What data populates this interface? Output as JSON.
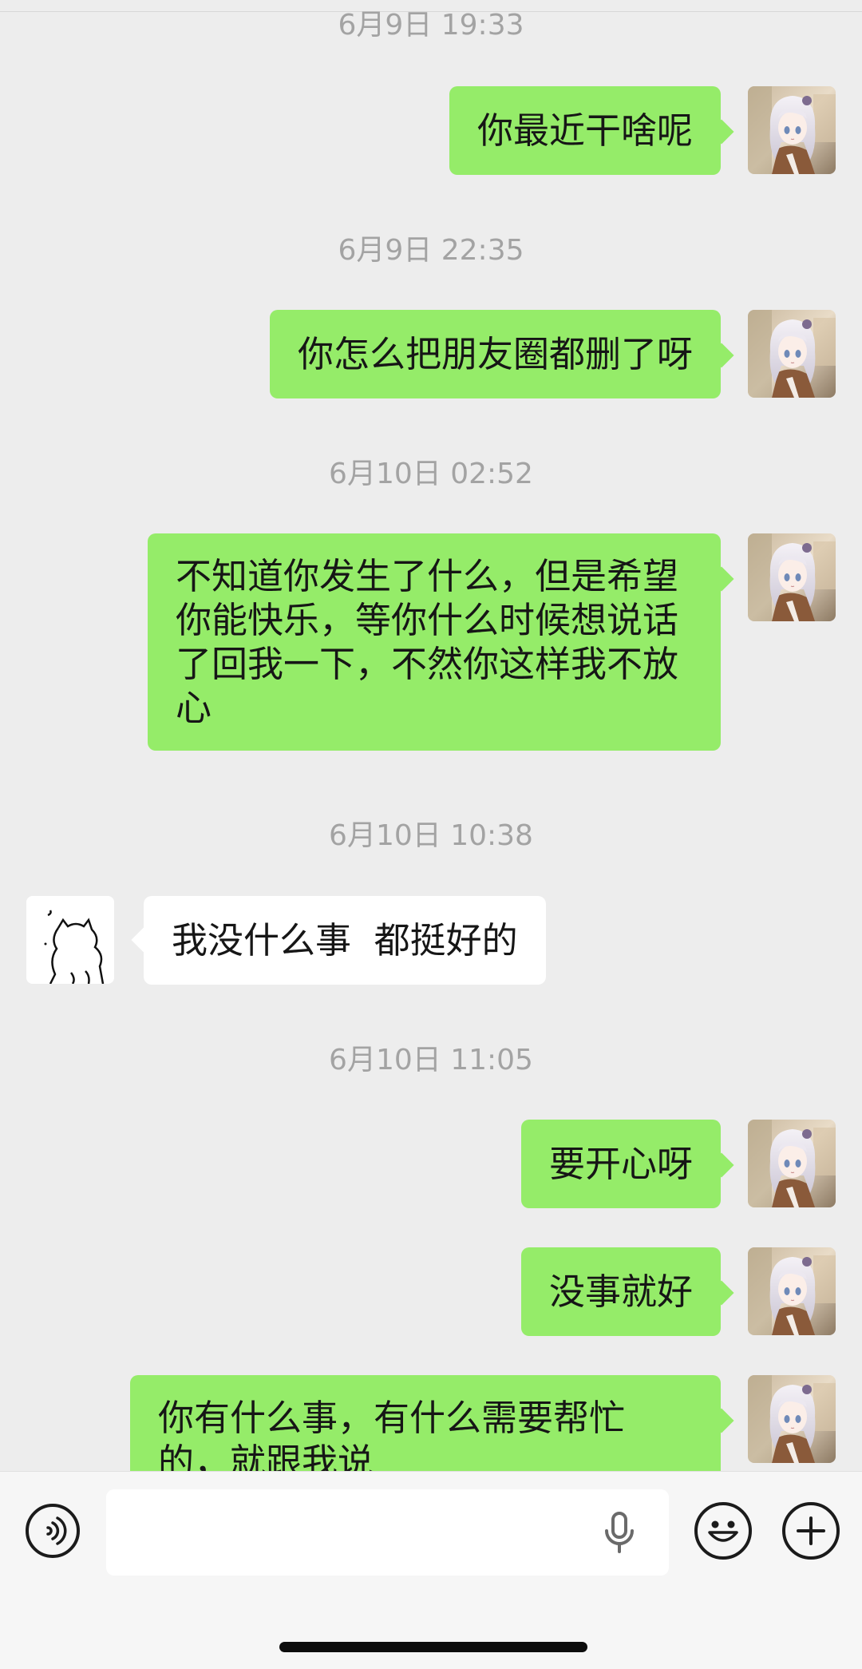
{
  "chat": {
    "messages": [
      {
        "timestamp": "6月9日 19:33",
        "from": "me",
        "text": "你最近干啥呢"
      },
      {
        "timestamp": "6月9日 22:35",
        "from": "me",
        "text": "你怎么把朋友圈都删了呀"
      },
      {
        "timestamp": "6月10日 02:52",
        "from": "me",
        "text": "不知道你发生了什么，但是希望你能快乐，等你什么时候想说话了回我一下，不然你这样我不放心"
      },
      {
        "timestamp": "6月10日 10:38",
        "from": "friend",
        "text": "我没什么事  都挺好的"
      },
      {
        "timestamp": "6月10日 11:05",
        "from": "me",
        "text": "要开心呀"
      },
      {
        "from": "me",
        "text": "没事就好"
      },
      {
        "from": "me",
        "text": "你有什么事，有什么需要帮忙的，就跟我说"
      }
    ]
  },
  "input_bar": {
    "icons": [
      "voice-icon",
      "microphone-icon",
      "emoji-icon",
      "plus-icon"
    ]
  },
  "colors": {
    "background": "#ededed",
    "my_bubble": "#95ec69",
    "friend_bubble": "#ffffff",
    "timestamp": "#a3a3a3"
  }
}
